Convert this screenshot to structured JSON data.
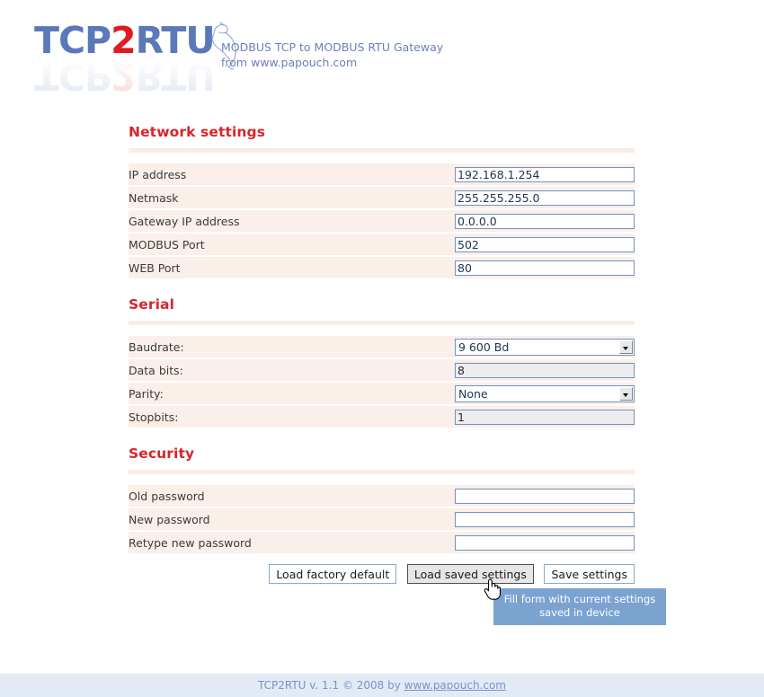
{
  "header": {
    "logo_text_1": "TCP",
    "logo_text_2": "2",
    "logo_text_3": "RTU",
    "bird_icon": "bird-icon",
    "tagline_line1": "MODBUS TCP to MODBUS RTU Gateway",
    "tagline_line2": "from www.papouch.com"
  },
  "sections": [
    {
      "title": "Network settings",
      "rows": [
        {
          "label": "IP address",
          "type": "text",
          "value": "192.168.1.254",
          "disabled": false
        },
        {
          "label": "Netmask",
          "type": "text",
          "value": "255.255.255.0",
          "disabled": false
        },
        {
          "label": "Gateway IP address",
          "type": "text",
          "value": "0.0.0.0",
          "disabled": false
        },
        {
          "label": "MODBUS Port",
          "type": "text",
          "value": "502",
          "disabled": false
        },
        {
          "label": "WEB Port",
          "type": "text",
          "value": "80",
          "disabled": false
        }
      ]
    },
    {
      "title": "Serial",
      "rows": [
        {
          "label": "Baudrate:",
          "type": "select",
          "value": "9 600 Bd",
          "disabled": false
        },
        {
          "label": "Data bits:",
          "type": "text",
          "value": "8",
          "disabled": true
        },
        {
          "label": "Parity:",
          "type": "select",
          "value": "None",
          "disabled": false
        },
        {
          "label": "Stopbits:",
          "type": "text",
          "value": "1",
          "disabled": true
        }
      ]
    },
    {
      "title": "Security",
      "rows": [
        {
          "label": "Old password",
          "type": "password",
          "value": "",
          "disabled": false
        },
        {
          "label": "New password",
          "type": "password",
          "value": "",
          "disabled": false
        },
        {
          "label": "Retype new password",
          "type": "password",
          "value": "",
          "disabled": false
        }
      ]
    }
  ],
  "buttons": {
    "load_factory_default": "Load factory default",
    "load_saved_settings": "Load saved settings",
    "save_settings": "Save settings"
  },
  "tooltip": {
    "text": "Fill form with current settings saved in device"
  },
  "cursor": {
    "icon": "pointing-hand-cursor"
  },
  "footer": {
    "text": "TCP2RTU v. 1.1 © 2008 by ",
    "link": "www.papouch.com"
  },
  "colors": {
    "heading_red": "#d6262b",
    "logo_blue": "#5b78b8",
    "logo_red": "#e01b20",
    "row_background": "#fbefe9",
    "input_border": "#6f93c4",
    "tooltip_background": "#7ba3d0",
    "footer_background": "#e2eaf6",
    "footer_text": "#7b92c4"
  }
}
